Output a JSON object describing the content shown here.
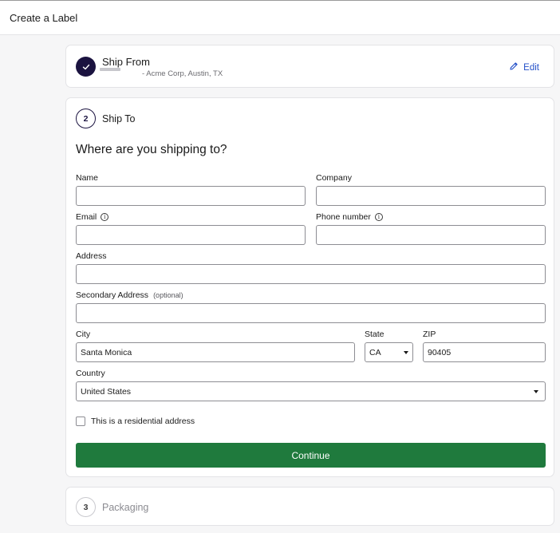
{
  "header": {
    "title": "Create a Label"
  },
  "ship_from": {
    "title": "Ship From",
    "subtitle": "- Acme Corp, Austin, TX",
    "edit_label": "Edit"
  },
  "ship_to": {
    "step_number": "2",
    "title": "Ship To",
    "heading": "Where are you shipping to?",
    "fields": {
      "name": {
        "label": "Name",
        "value": ""
      },
      "company": {
        "label": "Company",
        "value": ""
      },
      "email": {
        "label": "Email",
        "value": ""
      },
      "phone": {
        "label": "Phone number",
        "value": ""
      },
      "address": {
        "label": "Address",
        "value": ""
      },
      "secondary_address": {
        "label": "Secondary Address",
        "optional": "(optional)",
        "value": ""
      },
      "city": {
        "label": "City",
        "value": "Santa Monica"
      },
      "state": {
        "label": "State",
        "value": "CA"
      },
      "zip": {
        "label": "ZIP",
        "value": "90405"
      },
      "country": {
        "label": "Country",
        "value": "United States"
      }
    },
    "residential_label": "This is a residential address",
    "continue_label": "Continue"
  },
  "packaging": {
    "step_number": "3",
    "title": "Packaging"
  },
  "icons": {
    "check": "check-icon",
    "edit": "pencil-icon",
    "info": "info-icon",
    "caret": "chevron-down-icon"
  },
  "colors": {
    "accent_navy": "#1b1340",
    "link_blue": "#2350c8",
    "continue_green": "#1f7a3d"
  }
}
